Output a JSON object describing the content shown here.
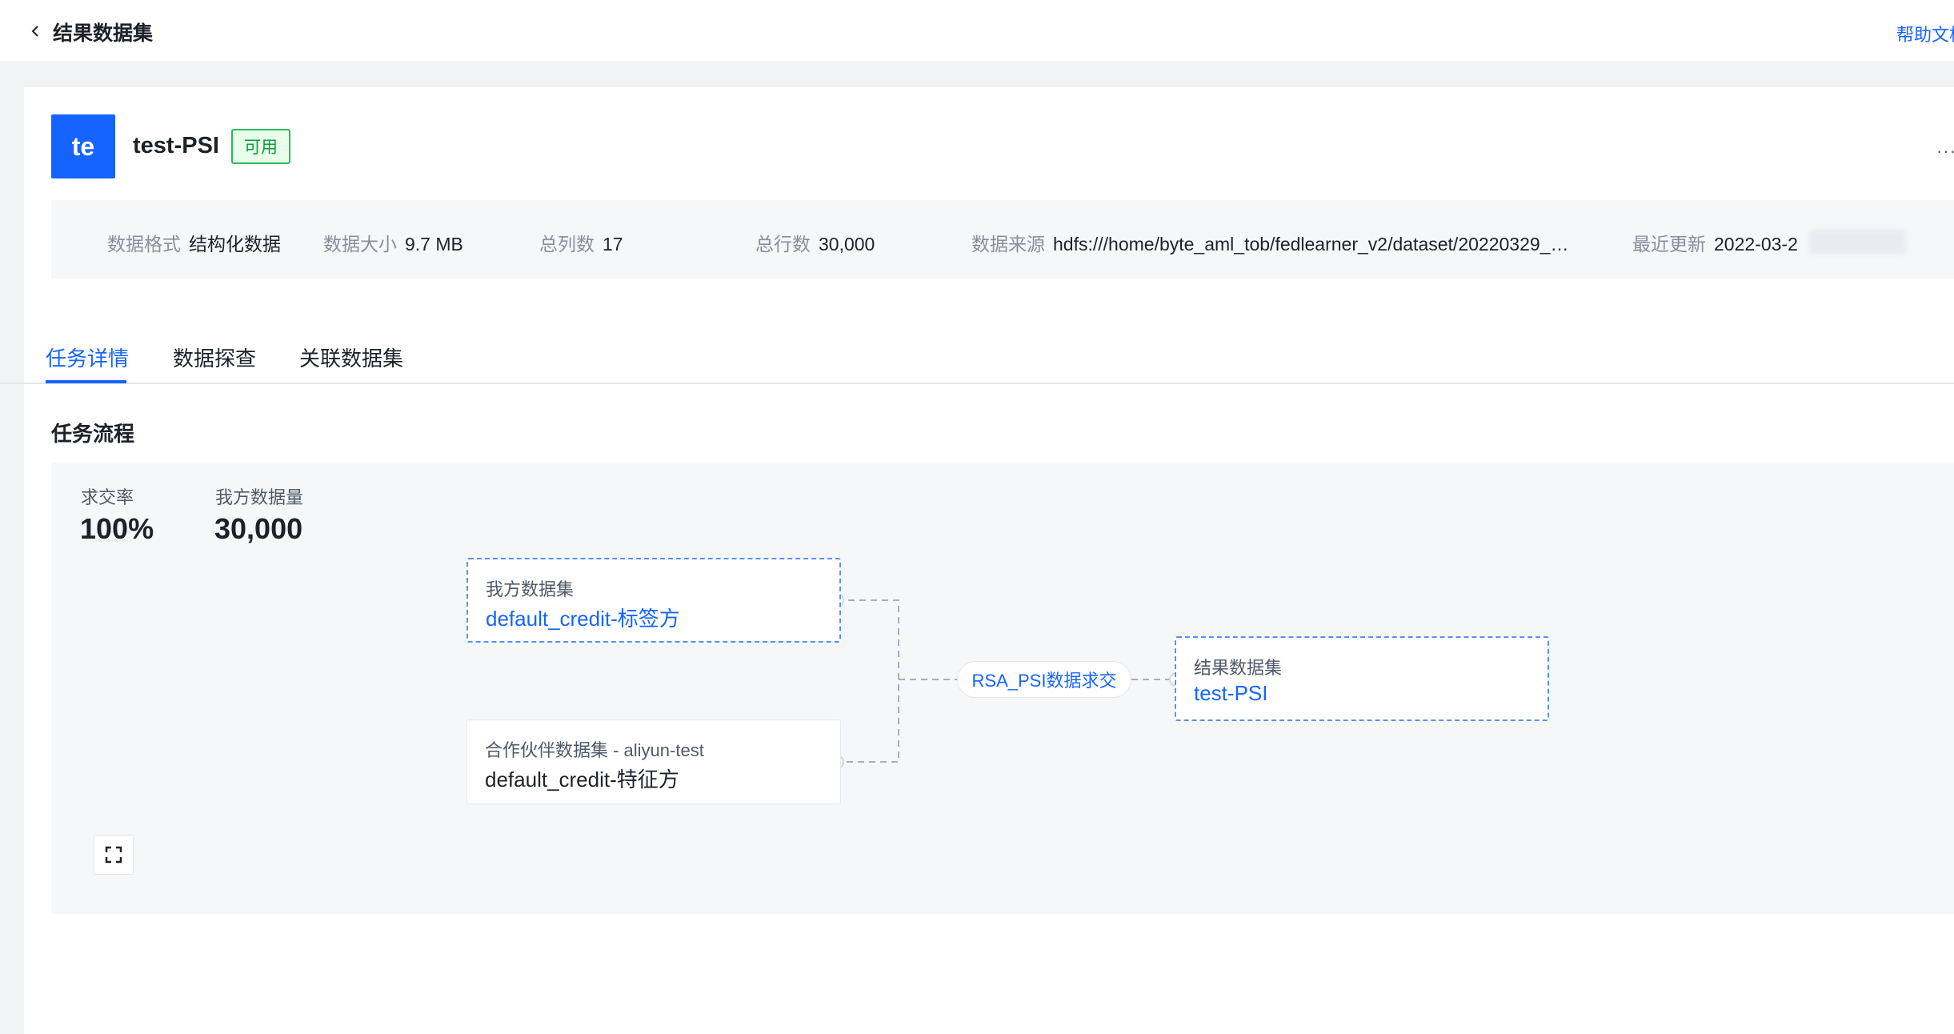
{
  "header": {
    "title": "结果数据集",
    "help_label": "帮助文档"
  },
  "dataset": {
    "avatar_text": "te",
    "name": "test-PSI",
    "status": "可用",
    "more_label": "···"
  },
  "info": [
    {
      "label": "数据格式",
      "value": "结构化数据"
    },
    {
      "label": "数据大小",
      "value": "9.7 MB"
    },
    {
      "label": "总列数",
      "value": "17"
    },
    {
      "label": "总行数",
      "value": "30,000"
    },
    {
      "label": "数据来源",
      "value": "hdfs:///home/byte_aml_tob/fedlearner_v2/dataset/20220329_…"
    },
    {
      "label": "最近更新",
      "value": "2022-03-2"
    }
  ],
  "tabs": [
    {
      "label": "任务详情"
    },
    {
      "label": "数据探查"
    },
    {
      "label": "关联数据集"
    }
  ],
  "section_title": "任务流程",
  "stats": [
    {
      "label": "求交率",
      "value": "100%"
    },
    {
      "label": "我方数据量",
      "value": "30,000"
    }
  ],
  "flow": {
    "own_node": {
      "label": "我方数据集",
      "title": "default_credit-标签方"
    },
    "partner_node": {
      "label": "合作伙伴数据集 - aliyun-test",
      "title": "default_credit-特征方"
    },
    "operation": "RSA_PSI数据求交",
    "result_node": {
      "label": "结果数据集",
      "title": "test-PSI"
    }
  },
  "colors": {
    "primary": "#1664ff",
    "success": "#00a136",
    "success_border": "#2dba5a",
    "canvas_bg": "#f6f7f9"
  }
}
